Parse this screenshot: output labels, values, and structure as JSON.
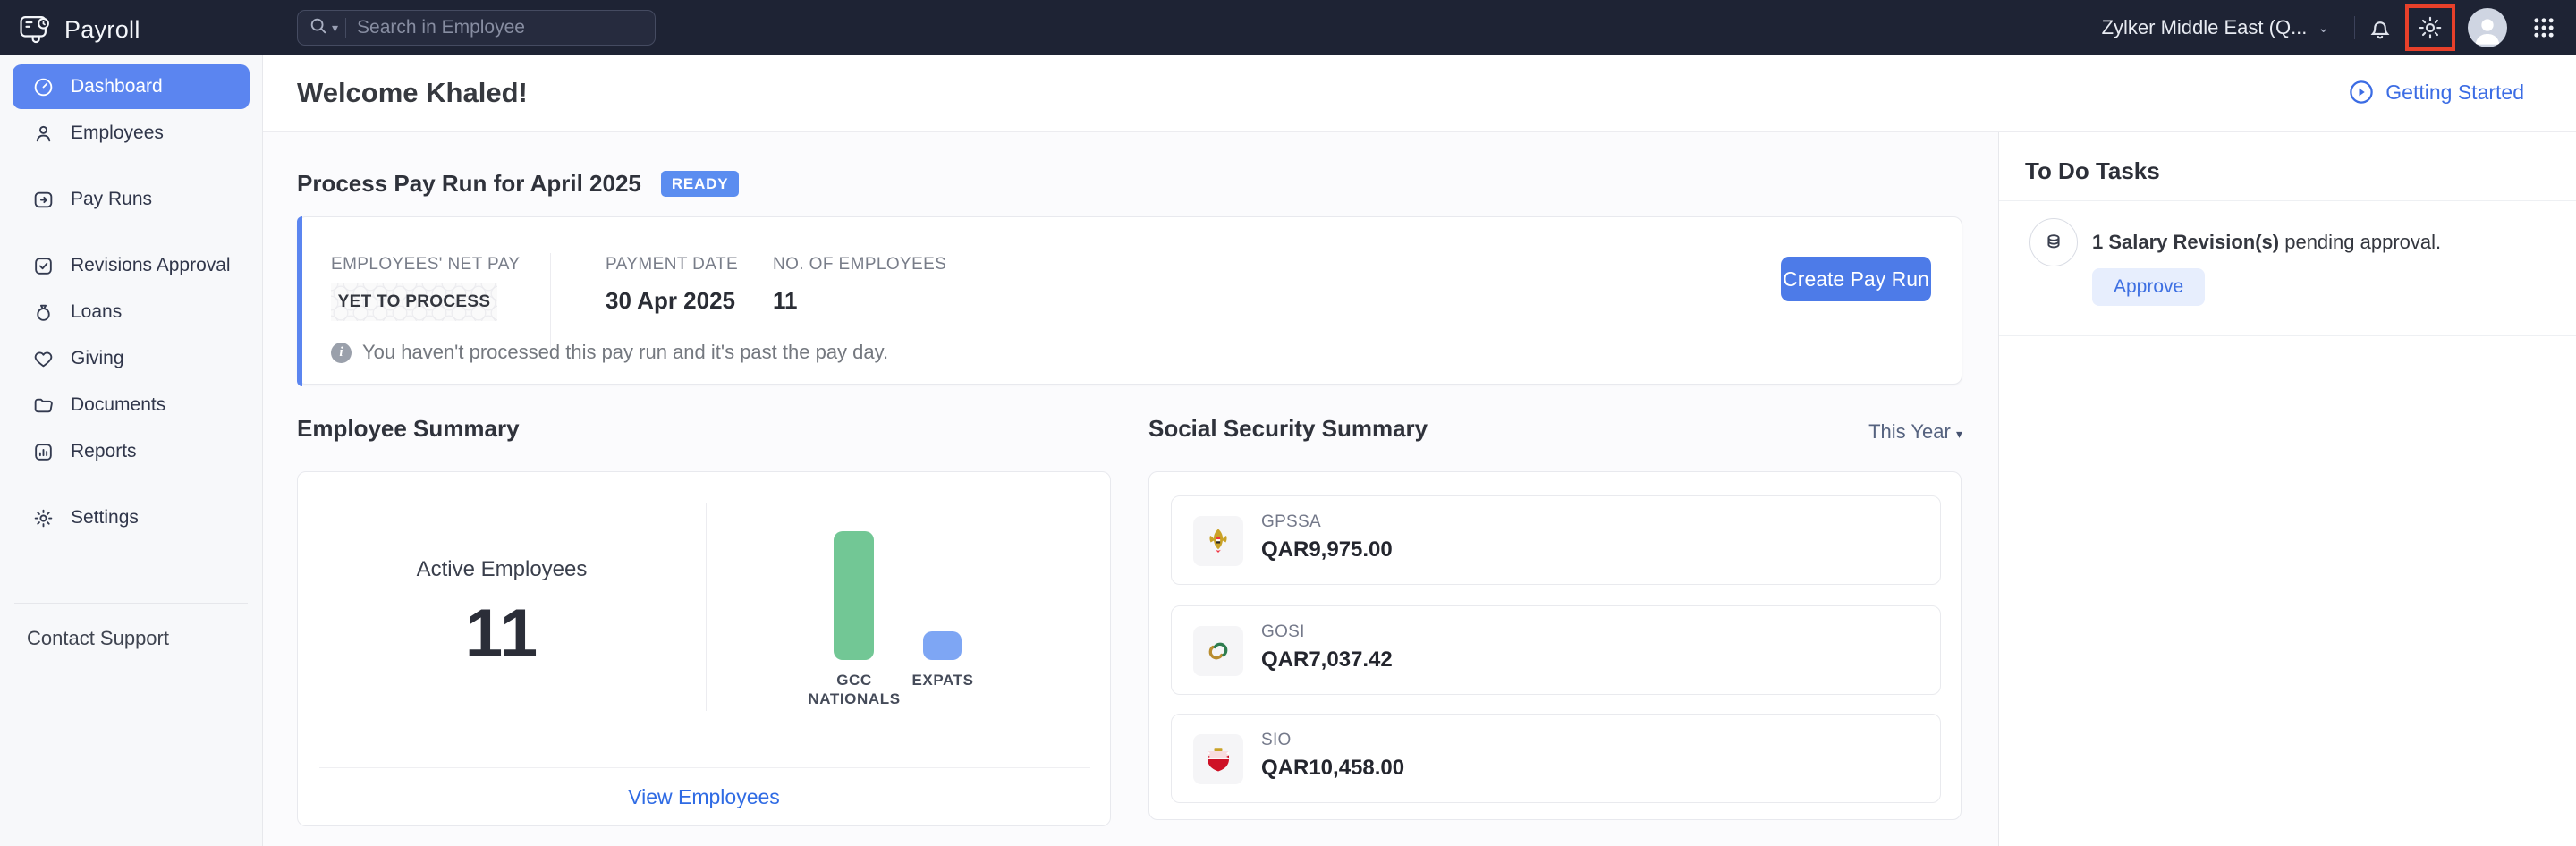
{
  "colors": {
    "topbar_bg": "#1e2334",
    "accent_blue": "#4d7be8",
    "active_nav": "#5b85f0",
    "ready_badge": "#5b8df0",
    "link_blue": "#2f6be4",
    "highlight_red": "#e8402a",
    "bar_green": "#72c795",
    "bar_blue": "#7ea6f4"
  },
  "icons": [
    "payroll-logo-icon",
    "search-icon",
    "caret-down-icon",
    "chevron-down-icon",
    "bell-icon",
    "gear-icon",
    "user-avatar",
    "apps-grid-icon",
    "play-circle-icon",
    "info-icon",
    "coins-icon",
    "uae-emblem",
    "gosi-logo",
    "bahrain-emblem"
  ],
  "topbar": {
    "app_name": "Payroll",
    "search_placeholder": "Search in Employee",
    "org_name": "Zylker Middle East (Q..."
  },
  "sidebar": {
    "items": [
      {
        "label": "Dashboard",
        "active": true
      },
      {
        "label": "Employees",
        "active": false
      },
      {
        "label": "Pay Runs",
        "active": false
      },
      {
        "label": "Revisions Approval",
        "active": false
      },
      {
        "label": "Loans",
        "active": false
      },
      {
        "label": "Giving",
        "active": false
      },
      {
        "label": "Documents",
        "active": false
      },
      {
        "label": "Reports",
        "active": false
      },
      {
        "label": "Settings",
        "active": false
      }
    ],
    "contact_support": "Contact Support"
  },
  "header": {
    "welcome": "Welcome Khaled!",
    "getting_started": "Getting Started"
  },
  "payrun": {
    "section_title": "Process Pay Run for April 2025",
    "status_badge": "READY",
    "fields": [
      {
        "label": "EMPLOYEES' NET PAY",
        "value": "YET TO PROCESS"
      },
      {
        "label": "PAYMENT DATE",
        "value": "30 Apr 2025"
      },
      {
        "label": "NO. OF EMPLOYEES",
        "value": "11"
      }
    ],
    "note": "You haven't processed this pay run and it's past the pay day.",
    "cta_label": "Create Pay Run"
  },
  "employee_summary": {
    "section_title": "Employee Summary",
    "active_label": "Active Employees",
    "active_count": "11",
    "link_label": "View Employees"
  },
  "chart_data": {
    "type": "bar",
    "title": "Employee Summary",
    "categories": [
      "GCC NATIONALS",
      "EXPATS"
    ],
    "values": [
      9,
      2
    ],
    "ylim": [
      0,
      9
    ],
    "colors": [
      "#72c795",
      "#7ea6f4"
    ],
    "legend": false,
    "axes_hidden": true
  },
  "social_security": {
    "section_title": "Social Security Summary",
    "period_label": "This Year",
    "rows": [
      {
        "name": "GPSSA",
        "amount": "QAR9,975.00",
        "icon": "uae-emblem"
      },
      {
        "name": "GOSI",
        "amount": "QAR7,037.42",
        "icon": "gosi-logo"
      },
      {
        "name": "SIO",
        "amount": "QAR10,458.00",
        "icon": "bahrain-emblem"
      }
    ]
  },
  "todo": {
    "section_title": "To Do Tasks",
    "task_bold": "1 Salary Revision(s)",
    "task_rest": " pending approval.",
    "approve_label": "Approve"
  }
}
